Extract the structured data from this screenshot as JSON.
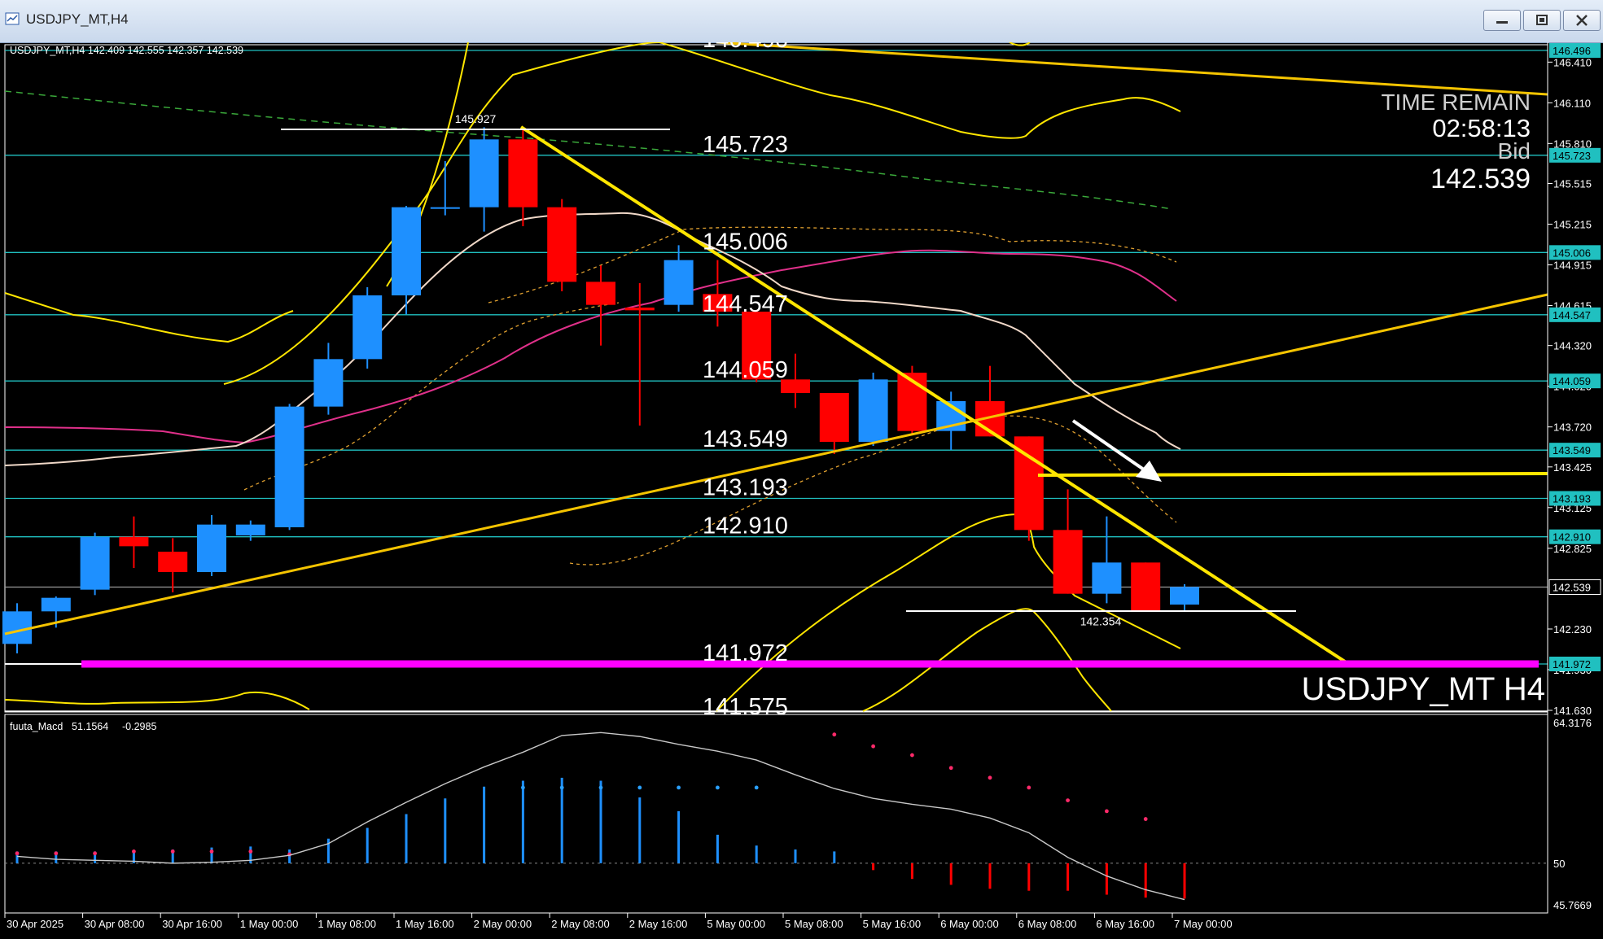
{
  "window": {
    "title": "USDJPY_MT,H4"
  },
  "chart_header": "USDJPY_MT,H4  142.409 142.555 142.357 142.539",
  "macd_header": {
    "name": "fuuta_Macd",
    "value1": "51.1564",
    "value2": "-0.2985"
  },
  "info": {
    "time_label": "TIME REMAIN",
    "time_value": "02:58:13",
    "bid_label": "Bid",
    "bid_value": "142.539"
  },
  "watermark": "USDJPY_MT H4",
  "colors": {
    "bull": "#1e90ff",
    "bear": "#ff0000",
    "level": "#20c0c0",
    "trend": "#ffe600",
    "support": "#ff00ff",
    "ma_pink": "#e0308a",
    "ma_white": "#f0d8c8",
    "band": "#ffe600"
  },
  "chart_data": {
    "type": "candlestick",
    "symbol": "USDJPY_MT",
    "timeframe": "H4",
    "ylim": [
      141.5,
      146.6
    ],
    "x_labels": [
      "30 Apr 2025",
      "30 Apr 08:00",
      "30 Apr 16:00",
      "1 May 00:00",
      "1 May 08:00",
      "1 May 16:00",
      "2 May 00:00",
      "2 May 08:00",
      "2 May 16:00",
      "5 May 00:00",
      "5 May 08:00",
      "5 May 16:00",
      "6 May 00:00",
      "6 May 08:00",
      "6 May 16:00",
      "7 May 00:00"
    ],
    "y_ticks": [
      "146.410",
      "146.110",
      "145.810",
      "145.515",
      "145.215",
      "144.915",
      "144.615",
      "144.320",
      "144.020",
      "143.720",
      "143.425",
      "143.125",
      "142.825",
      "142.230",
      "141.930",
      "141.630"
    ],
    "level_boxes": [
      {
        "label": "146.496",
        "value": 146.496
      },
      {
        "label": "145.723",
        "value": 145.723
      },
      {
        "label": "145.006",
        "value": 145.006
      },
      {
        "label": "144.547",
        "value": 144.547
      },
      {
        "label": "144.059",
        "value": 144.059
      },
      {
        "label": "143.549",
        "value": 143.549
      },
      {
        "label": "143.193",
        "value": 143.193
      },
      {
        "label": "142.910",
        "value": 142.91
      },
      {
        "label": "142.539",
        "value": 142.539
      },
      {
        "label": "141.972",
        "value": 141.972
      }
    ],
    "level_labels": [
      {
        "label": "146.496",
        "value": 146.496
      },
      {
        "label": "145.723",
        "value": 145.723
      },
      {
        "label": "145.006",
        "value": 145.006
      },
      {
        "label": "144.547",
        "value": 144.547
      },
      {
        "label": "144.059",
        "value": 144.059
      },
      {
        "label": "143.549",
        "value": 143.549
      },
      {
        "label": "143.193",
        "value": 143.193
      },
      {
        "label": "142.910",
        "value": 142.91
      },
      {
        "label": "141.972",
        "value": 141.972
      },
      {
        "label": "141.575",
        "value": 141.575
      }
    ],
    "annotations": [
      {
        "label": "145.927",
        "value": 145.927
      },
      {
        "label": "142.354",
        "value": 142.354
      }
    ],
    "candles": [
      {
        "o": 142.12,
        "h": 142.42,
        "l": 142.05,
        "c": 142.36
      },
      {
        "o": 142.36,
        "h": 142.47,
        "l": 142.24,
        "c": 142.46
      },
      {
        "o": 142.52,
        "h": 142.94,
        "l": 142.48,
        "c": 142.91
      },
      {
        "o": 142.91,
        "h": 143.06,
        "l": 142.68,
        "c": 142.84
      },
      {
        "o": 142.8,
        "h": 142.9,
        "l": 142.5,
        "c": 142.65
      },
      {
        "o": 142.65,
        "h": 143.07,
        "l": 142.62,
        "c": 143.0
      },
      {
        "o": 142.92,
        "h": 143.03,
        "l": 142.88,
        "c": 143.0
      },
      {
        "o": 142.98,
        "h": 143.89,
        "l": 142.96,
        "c": 143.87
      },
      {
        "o": 143.87,
        "h": 144.34,
        "l": 143.81,
        "c": 144.22
      },
      {
        "o": 144.22,
        "h": 144.75,
        "l": 144.15,
        "c": 144.69
      },
      {
        "o": 144.69,
        "h": 145.35,
        "l": 144.55,
        "c": 145.34
      },
      {
        "o": 145.34,
        "h": 145.68,
        "l": 145.28,
        "c": 145.34
      },
      {
        "o": 145.34,
        "h": 145.93,
        "l": 145.16,
        "c": 145.84
      },
      {
        "o": 145.84,
        "h": 145.93,
        "l": 145.2,
        "c": 145.34
      },
      {
        "o": 145.34,
        "h": 145.4,
        "l": 144.72,
        "c": 144.79
      },
      {
        "o": 144.79,
        "h": 144.91,
        "l": 144.32,
        "c": 144.62
      },
      {
        "o": 144.6,
        "h": 144.78,
        "l": 143.73,
        "c": 144.58
      },
      {
        "o": 144.62,
        "h": 145.06,
        "l": 144.57,
        "c": 144.95
      },
      {
        "o": 144.7,
        "h": 144.95,
        "l": 144.46,
        "c": 144.57
      },
      {
        "o": 144.57,
        "h": 144.57,
        "l": 144.05,
        "c": 144.07
      },
      {
        "o": 144.07,
        "h": 144.26,
        "l": 143.86,
        "c": 143.97
      },
      {
        "o": 143.97,
        "h": 143.97,
        "l": 143.52,
        "c": 143.61
      },
      {
        "o": 143.61,
        "h": 144.12,
        "l": 143.58,
        "c": 144.07
      },
      {
        "o": 144.12,
        "h": 144.17,
        "l": 143.66,
        "c": 143.69
      },
      {
        "o": 143.69,
        "h": 143.98,
        "l": 143.55,
        "c": 143.91
      },
      {
        "o": 143.91,
        "h": 144.17,
        "l": 143.65,
        "c": 143.65
      },
      {
        "o": 143.65,
        "h": 143.65,
        "l": 142.88,
        "c": 142.96
      },
      {
        "o": 142.96,
        "h": 143.26,
        "l": 142.49,
        "c": 142.49
      },
      {
        "o": 142.49,
        "h": 143.06,
        "l": 142.42,
        "c": 142.72
      },
      {
        "o": 142.72,
        "h": 142.72,
        "l": 142.36,
        "c": 142.36
      },
      {
        "o": 142.41,
        "h": 142.56,
        "l": 142.36,
        "c": 142.54
      }
    ],
    "macd": {
      "ylim": [
        45.7669,
        64.3176
      ],
      "y_ticks": [
        "64.3176",
        "50",
        "45.7669"
      ],
      "histogram": [
        51.2,
        51.2,
        51.2,
        51.3,
        51.4,
        51.6,
        51.7,
        51.4,
        52.5,
        53.6,
        55.0,
        56.6,
        57.8,
        58.4,
        58.7,
        58.4,
        56.7,
        55.3,
        52.9,
        51.8,
        51.4,
        51.2,
        49.3,
        48.4,
        47.8,
        47.4,
        47.2,
        47.2,
        46.8,
        46.5,
        46.4
      ],
      "signal_dots": [
        51.0,
        51.0,
        51.0,
        51.2,
        51.2,
        51.2,
        51.2,
        50.9,
        null,
        null,
        null,
        null,
        null,
        57.7,
        57.7,
        57.7,
        57.7,
        57.7,
        57.7,
        57.7,
        null,
        63.1,
        61.9,
        61.0,
        59.7,
        58.7,
        57.7,
        56.4,
        55.3,
        54.5,
        null
      ],
      "line": [
        50.7,
        50.4,
        50.3,
        50.2,
        50.0,
        50.1,
        50.3,
        50.8,
        52.0,
        54.2,
        56.2,
        58.1,
        59.8,
        61.3,
        63.0,
        63.3,
        62.9,
        62.1,
        61.4,
        60.5,
        59.0,
        57.6,
        56.6,
        56.0,
        55.5,
        54.6,
        53.1,
        50.6,
        48.7,
        47.3,
        46.3
      ]
    }
  }
}
